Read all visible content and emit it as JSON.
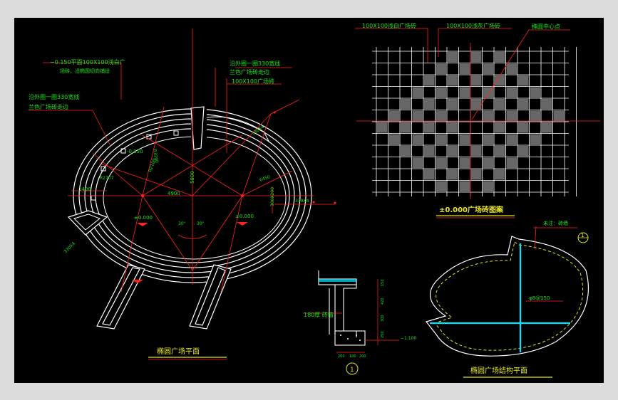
{
  "colors": {
    "frame_bg": "#dcdcdc",
    "drawing_bg": "#000000",
    "white": "#ffffff",
    "red": "#ff2020",
    "green": "#19e619",
    "yellow": "#e6e619",
    "cyan": "#00e5ff"
  },
  "plan": {
    "title": "椭圆广场平面",
    "label_tl1": "沿外圈一圈330宽线",
    "label_tl2": "兰色广场砖走边",
    "label_top1": "−0.150平面100X100浅白广",
    "label_top2": "场砖，沿椭圆切向铺设",
    "label_tr1": "沿外圈一圈330宽线",
    "label_tr2": "兰色广场砖走边",
    "label_tr3": "100X100广场砖",
    "dim_4900": "4900",
    "dim_5800": "5800",
    "dim_r3200": "R3200",
    "dim_r2100": "R2100",
    "dim_r2707": "R2707",
    "dim_6450": "6450",
    "dim_1400": "1400",
    "elev_0150": "-0.150",
    "elev_0000a": "±0.000",
    "elev_0000b": "±0.000",
    "angle_a": "30°",
    "angle_b": "30°",
    "dim_side": "300X200",
    "dim_bl": "330X4",
    "dim_right": "330X4"
  },
  "pattern": {
    "title": "±0.000广场砖图案",
    "label1": "100X100浅白广场砖",
    "label2": "100X100浅灰广场砖",
    "label3": "椭圆中心点"
  },
  "section": {
    "label_edge": "180厚 砖墙",
    "dim_150": "150",
    "dim_420": "420",
    "dim_300": "300",
    "dim_250": "250",
    "dim_200a": "200",
    "dim_180": "180",
    "dim_200b": "200",
    "elev": "−1.100",
    "marker": "1"
  },
  "structure": {
    "title": "椭圆广场结构平面",
    "note": "未注：砖墙",
    "marker": "1",
    "rebar": "φ8@150"
  }
}
